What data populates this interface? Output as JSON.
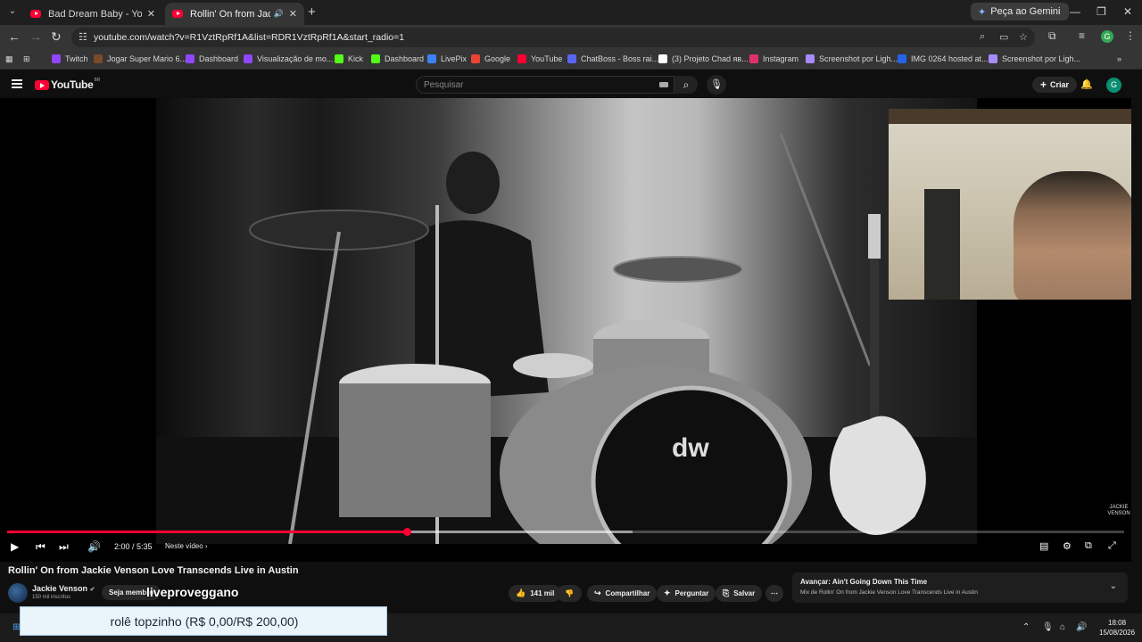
{
  "browser": {
    "tabs": [
      {
        "title": "Bad Dream Baby - YouTube",
        "active": false
      },
      {
        "title": "Rollin' On from Jackie Venso",
        "active": true
      }
    ],
    "gemini_label": "Peça ao Gemini",
    "url": "youtube.com/watch?v=R1VztRpRf1A&list=RDR1VztRpRf1A&start_radio=1",
    "profile_initial": "G"
  },
  "bookmarks": [
    {
      "label": "Twitch",
      "color": "#9146ff"
    },
    {
      "label": "Jogar Super Mario 6...",
      "color": "#7a4a2a"
    },
    {
      "label": "Dashboard",
      "color": "#9146ff"
    },
    {
      "label": "Visualização de mo...",
      "color": "#9146ff"
    },
    {
      "label": "Kick",
      "color": "#53fc18"
    },
    {
      "label": "Dashboard",
      "color": "#53fc18"
    },
    {
      "label": "LivePix",
      "color": "#3b82f6"
    },
    {
      "label": "Google",
      "color": "#ea4335"
    },
    {
      "label": "YouTube",
      "color": "#ff0033"
    },
    {
      "label": "ChatBoss - Boss rai...",
      "color": "#5865f2"
    },
    {
      "label": "(3) Projeto Chad яв...",
      "color": "#ffffff"
    },
    {
      "label": "Instagram",
      "color": "#e1306c"
    },
    {
      "label": "Screenshot por Ligh...",
      "color": "#a78bfa"
    },
    {
      "label": "IMG 0264 hosted at...",
      "color": "#2563eb"
    },
    {
      "label": "Screenshot por Ligh...",
      "color": "#a78bfa"
    }
  ],
  "youtube": {
    "logo_text": "YouTube",
    "country_code": "BR",
    "search_placeholder": "Pesquisar",
    "create_label": "Criar",
    "avatar_initial": "G"
  },
  "player": {
    "time": "2:00 / 5:35",
    "chapter": "Neste vídeo",
    "progress_fraction": 0.358,
    "buffer_fraction": 0.56,
    "watermark": "JACKIE VENSON"
  },
  "video": {
    "title": "Rollin' On from Jackie Venson Love Transcends Live in Austin",
    "channel": "Jackie Venson",
    "subscribers": "150 mil inscritos",
    "join_label": "Seja membro",
    "stream_overlay_name": "liveproveggano",
    "likes": "141 mil",
    "share_label": "Compartilhar",
    "ask_label": "Perguntar",
    "save_label": "Salvar"
  },
  "autoplay": {
    "next": "Avançar: Ain't Going Down This Time",
    "mix": "Mix de Rollin' On from Jackie Venson Love Transcends Live in Austin"
  },
  "goal": {
    "text": "rolê topzinho (R$ 0,00/R$ 200,00)"
  },
  "taskbar": {
    "time": "18:08",
    "date": "15/08/2026"
  },
  "colors": {
    "accent": "#ff0033",
    "background": "#0f0f0f"
  }
}
